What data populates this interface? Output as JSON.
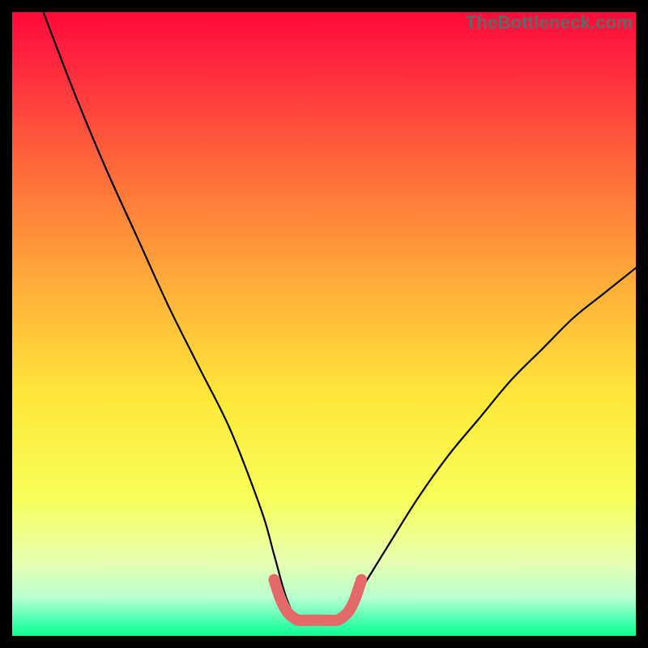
{
  "watermark": "TheBottleneck.com",
  "chart_data": {
    "type": "line",
    "title": "",
    "xlabel": "",
    "ylabel": "",
    "xlim": [
      0,
      100
    ],
    "ylim": [
      0,
      100
    ],
    "series": [
      {
        "name": "bottleneck-curve",
        "x": [
          5,
          10,
          15,
          20,
          25,
          30,
          35,
          40,
          42,
          44,
          46,
          48,
          50,
          52,
          55,
          60,
          65,
          70,
          75,
          80,
          85,
          90,
          95,
          100
        ],
        "y": [
          100,
          87,
          75,
          64,
          53,
          43,
          33,
          20,
          13,
          6,
          2,
          2,
          2,
          2,
          6,
          14,
          22,
          29,
          35,
          41,
          46,
          51,
          55,
          59
        ]
      },
      {
        "name": "optimal-zone-marker",
        "x": [
          42,
          43,
          44,
          45,
          46,
          48,
          50,
          52,
          53,
          54,
          55,
          56
        ],
        "y": [
          9,
          6,
          4,
          3,
          2.5,
          2.5,
          2.5,
          2.5,
          3,
          4,
          6,
          9
        ]
      }
    ],
    "gradient_bands": [
      {
        "stop": 0.0,
        "color": "#ff0a3a"
      },
      {
        "stop": 0.1,
        "color": "#ff2e3f"
      },
      {
        "stop": 0.25,
        "color": "#ff6a3a"
      },
      {
        "stop": 0.45,
        "color": "#ffb23a"
      },
      {
        "stop": 0.62,
        "color": "#ffe83a"
      },
      {
        "stop": 0.78,
        "color": "#f7ff5a"
      },
      {
        "stop": 0.88,
        "color": "#e8ffb0"
      },
      {
        "stop": 0.94,
        "color": "#b6ffd0"
      },
      {
        "stop": 0.975,
        "color": "#4bffb0"
      },
      {
        "stop": 1.0,
        "color": "#0aff90"
      }
    ]
  }
}
